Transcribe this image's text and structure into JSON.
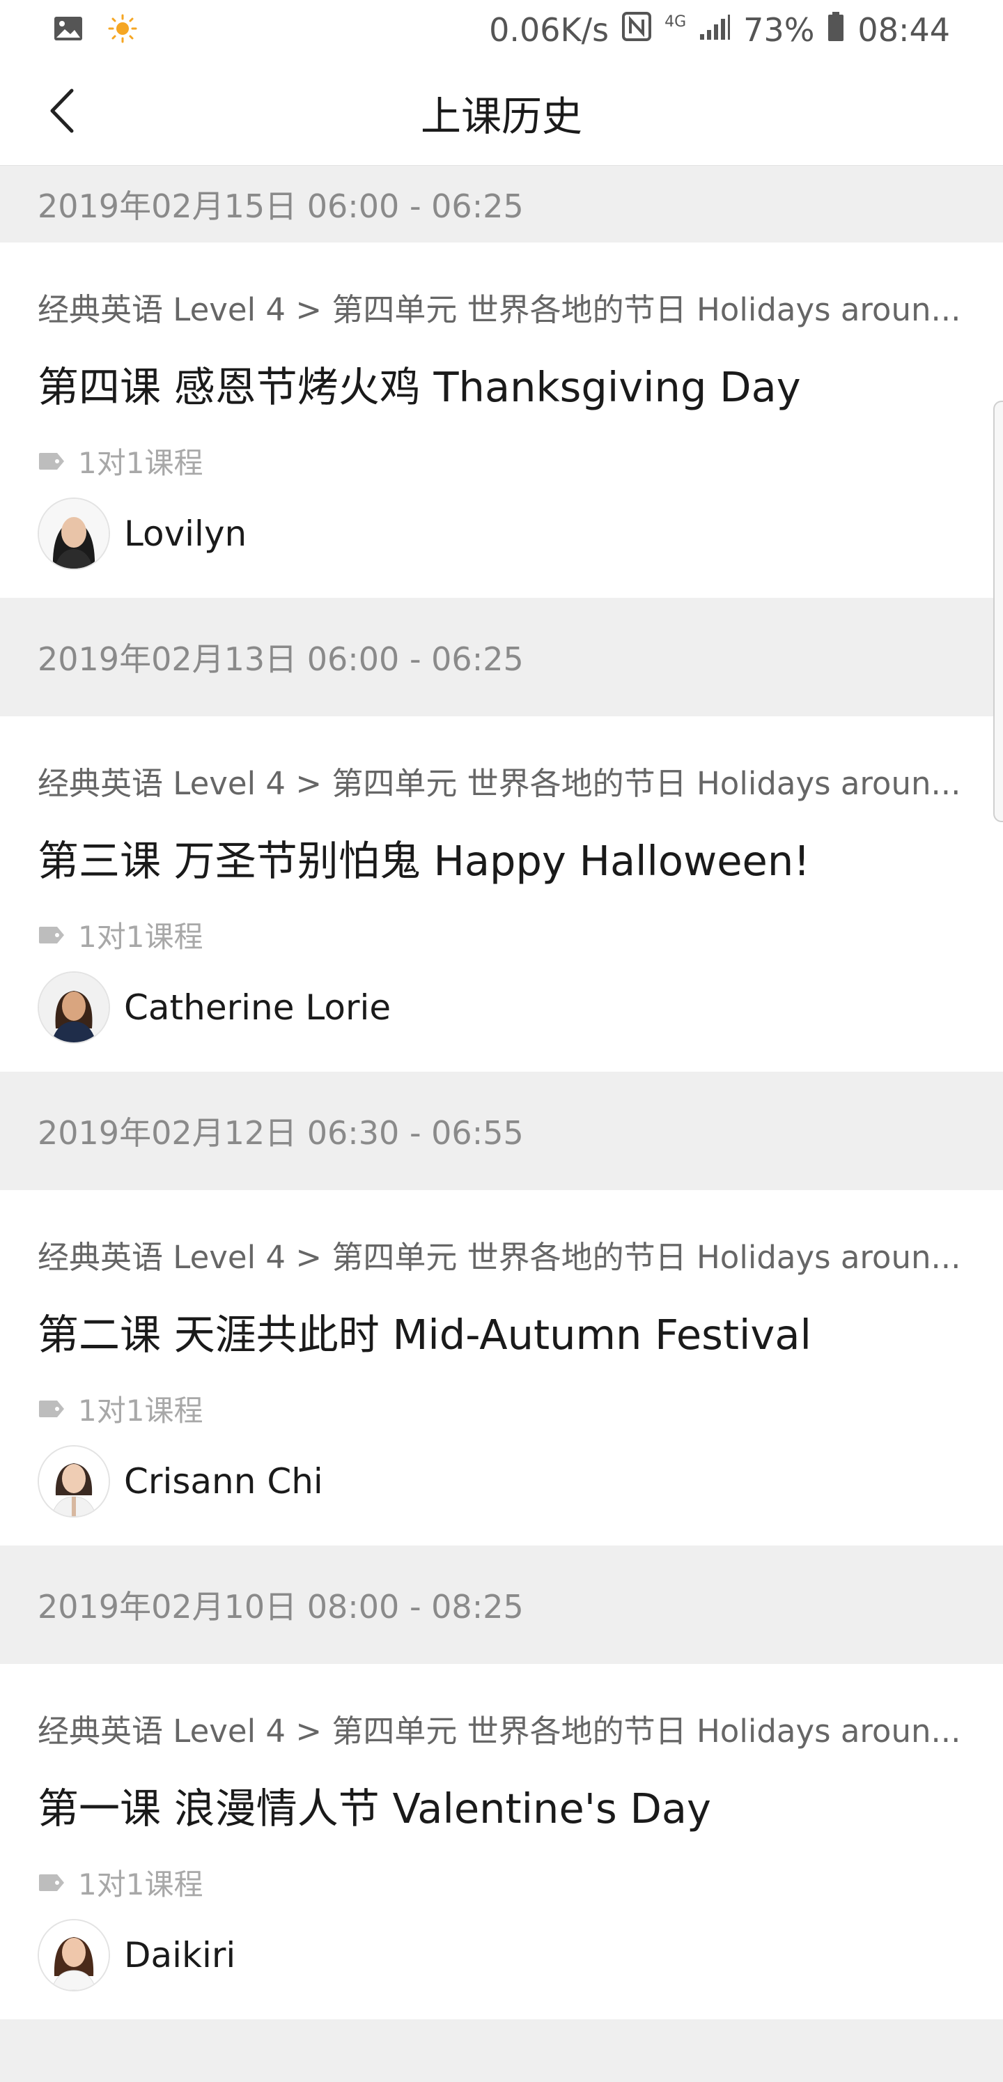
{
  "status_bar": {
    "network_speed": "0.06K/s",
    "network_type": "4G",
    "battery": "73%",
    "time": "08:44",
    "icons": [
      "gallery-icon",
      "sun-icon",
      "nfc-icon",
      "signal-icon",
      "battery-icon"
    ]
  },
  "header": {
    "title": "上课历史",
    "back_icon": "chevron-left-icon"
  },
  "colors": {
    "background": "#efefef",
    "card": "#ffffff",
    "muted_text": "#8a8a8a",
    "tag_text": "#a8a8a8"
  },
  "lessons": [
    {
      "date": "2019年02月15日 06:00 - 06:25",
      "course_path": "经典英语 Level 4 > 第四单元 世界各地的节日 Holidays aroun...",
      "title": "第四课 感恩节烤火鸡 Thanksgiving Day",
      "tag": "1对1课程",
      "teacher": "Lovilyn"
    },
    {
      "date": "2019年02月13日 06:00 - 06:25",
      "course_path": "经典英语 Level 4 > 第四单元 世界各地的节日 Holidays aroun...",
      "title": "第三课 万圣节别怕鬼 Happy Halloween!",
      "tag": "1对1课程",
      "teacher": "Catherine Lorie"
    },
    {
      "date": "2019年02月12日 06:30 - 06:55",
      "course_path": "经典英语 Level 4 > 第四单元 世界各地的节日 Holidays aroun...",
      "title": "第二课 天涯共此时 Mid-Autumn Festival",
      "tag": "1对1课程",
      "teacher": "Crisann Chi"
    },
    {
      "date": "2019年02月10日 08:00 - 08:25",
      "course_path": "经典英语 Level 4 > 第四单元 世界各地的节日 Holidays aroun...",
      "title": "第一课 浪漫情人节 Valentine's Day",
      "tag": "1对1课程",
      "teacher": "Daikiri"
    }
  ]
}
